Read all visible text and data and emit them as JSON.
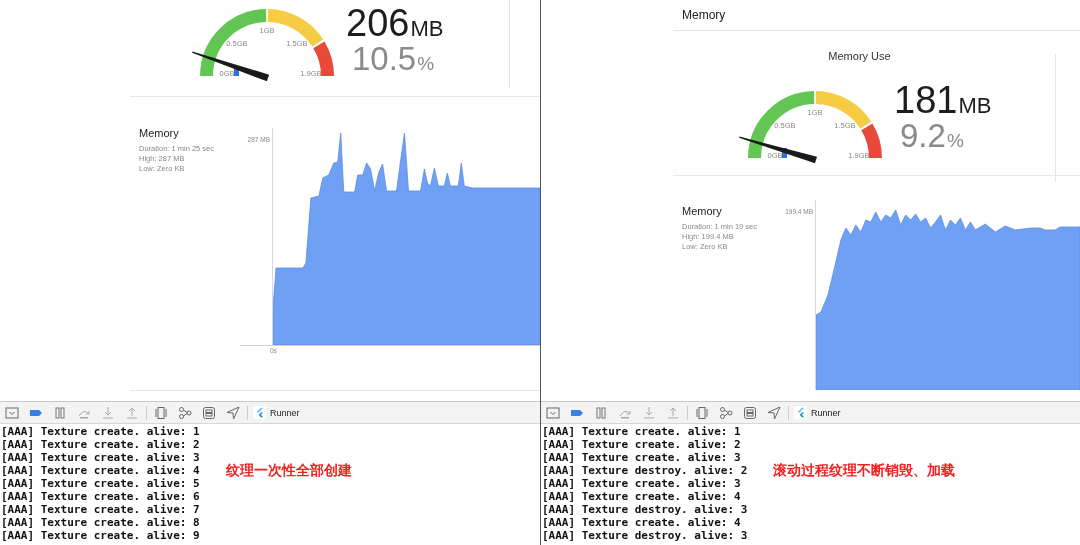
{
  "panels": [
    {
      "gauge": {
        "scale_labels": [
          "0GB",
          "0.5GB",
          "1GB",
          "1.5GB",
          "1.9GB"
        ],
        "value": "206",
        "unit": "MB",
        "percent": "10.5",
        "percent_unit": "%"
      },
      "graph": {
        "title": "Memory",
        "details": [
          "Duration: 1 min 25 sec",
          "High: 287 MB",
          "Low: Zero KB"
        ],
        "y_label": "287 MB",
        "x_label": "0s",
        "kind": "rise-once"
      },
      "toolbar": {
        "target": "Runner"
      },
      "console": {
        "lines": [
          "[AAA] Texture create. alive: 1",
          "[AAA] Texture create. alive: 2",
          "[AAA] Texture create. alive: 3",
          "[AAA] Texture create. alive: 4",
          "[AAA] Texture create. alive: 5",
          "[AAA] Texture create. alive: 6",
          "[AAA] Texture create. alive: 7",
          "[AAA] Texture create. alive: 8",
          "[AAA] Texture create. alive: 9"
        ]
      },
      "annotation": "纹理一次性全部创建"
    },
    {
      "header": "Memory",
      "gauge": {
        "title": "Memory Use",
        "scale_labels": [
          "0GB",
          "0.5GB",
          "1GB",
          "1.5GB",
          "1.9GB"
        ],
        "value": "181",
        "unit": "MB",
        "percent": "9.2",
        "percent_unit": "%"
      },
      "graph": {
        "title": "Memory",
        "details": [
          "Duration: 1 min 19 sec",
          "High: 199.4 MB",
          "Low: Zero KB"
        ],
        "y_label": "199.4 MB",
        "kind": "fluctuating"
      },
      "toolbar": {
        "target": "Runner"
      },
      "console": {
        "lines": [
          "[AAA] Texture create. alive: 1",
          "[AAA] Texture create. alive: 2",
          "[AAA] Texture create. alive: 3",
          "[AAA] Texture destroy. alive: 2",
          "[AAA] Texture create. alive: 3",
          "[AAA] Texture create. alive: 4",
          "[AAA] Texture destroy. alive: 3",
          "[AAA] Texture create. alive: 4",
          "[AAA] Texture destroy. alive: 3"
        ]
      },
      "annotation": "滚动过程纹理不断销毁、加载"
    }
  ]
}
